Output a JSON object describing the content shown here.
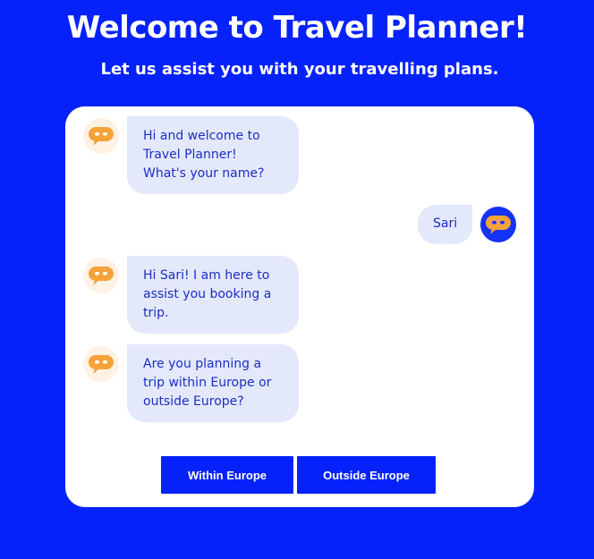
{
  "header": {
    "title": "Welcome to Travel Planner!",
    "subtitle": "Let us assist you with your travelling plans."
  },
  "chat": {
    "messages": [
      {
        "sender": "bot",
        "text": "Hi and welcome to Travel Planner! What's your name?"
      },
      {
        "sender": "user",
        "text": "Sari"
      },
      {
        "sender": "bot",
        "text": "Hi Sari! I am here to assist you booking a trip."
      },
      {
        "sender": "bot",
        "text": "Are you planning a trip within Europe or outside Europe?"
      }
    ],
    "options": [
      {
        "label": "Within Europe"
      },
      {
        "label": "Outside Europe"
      }
    ]
  },
  "colors": {
    "background": "#0622fb",
    "card": "#ffffff",
    "bubble": "#e4e8fb",
    "bubble_text": "#1b2fc4",
    "bot_icon": "#f6a23a",
    "bot_avatar_bg": "#fff1e4",
    "user_avatar_bg": "#1532f8"
  },
  "icons": {
    "bot_avatar": "chat-bubble-icon",
    "user_avatar": "chat-bubble-icon"
  }
}
